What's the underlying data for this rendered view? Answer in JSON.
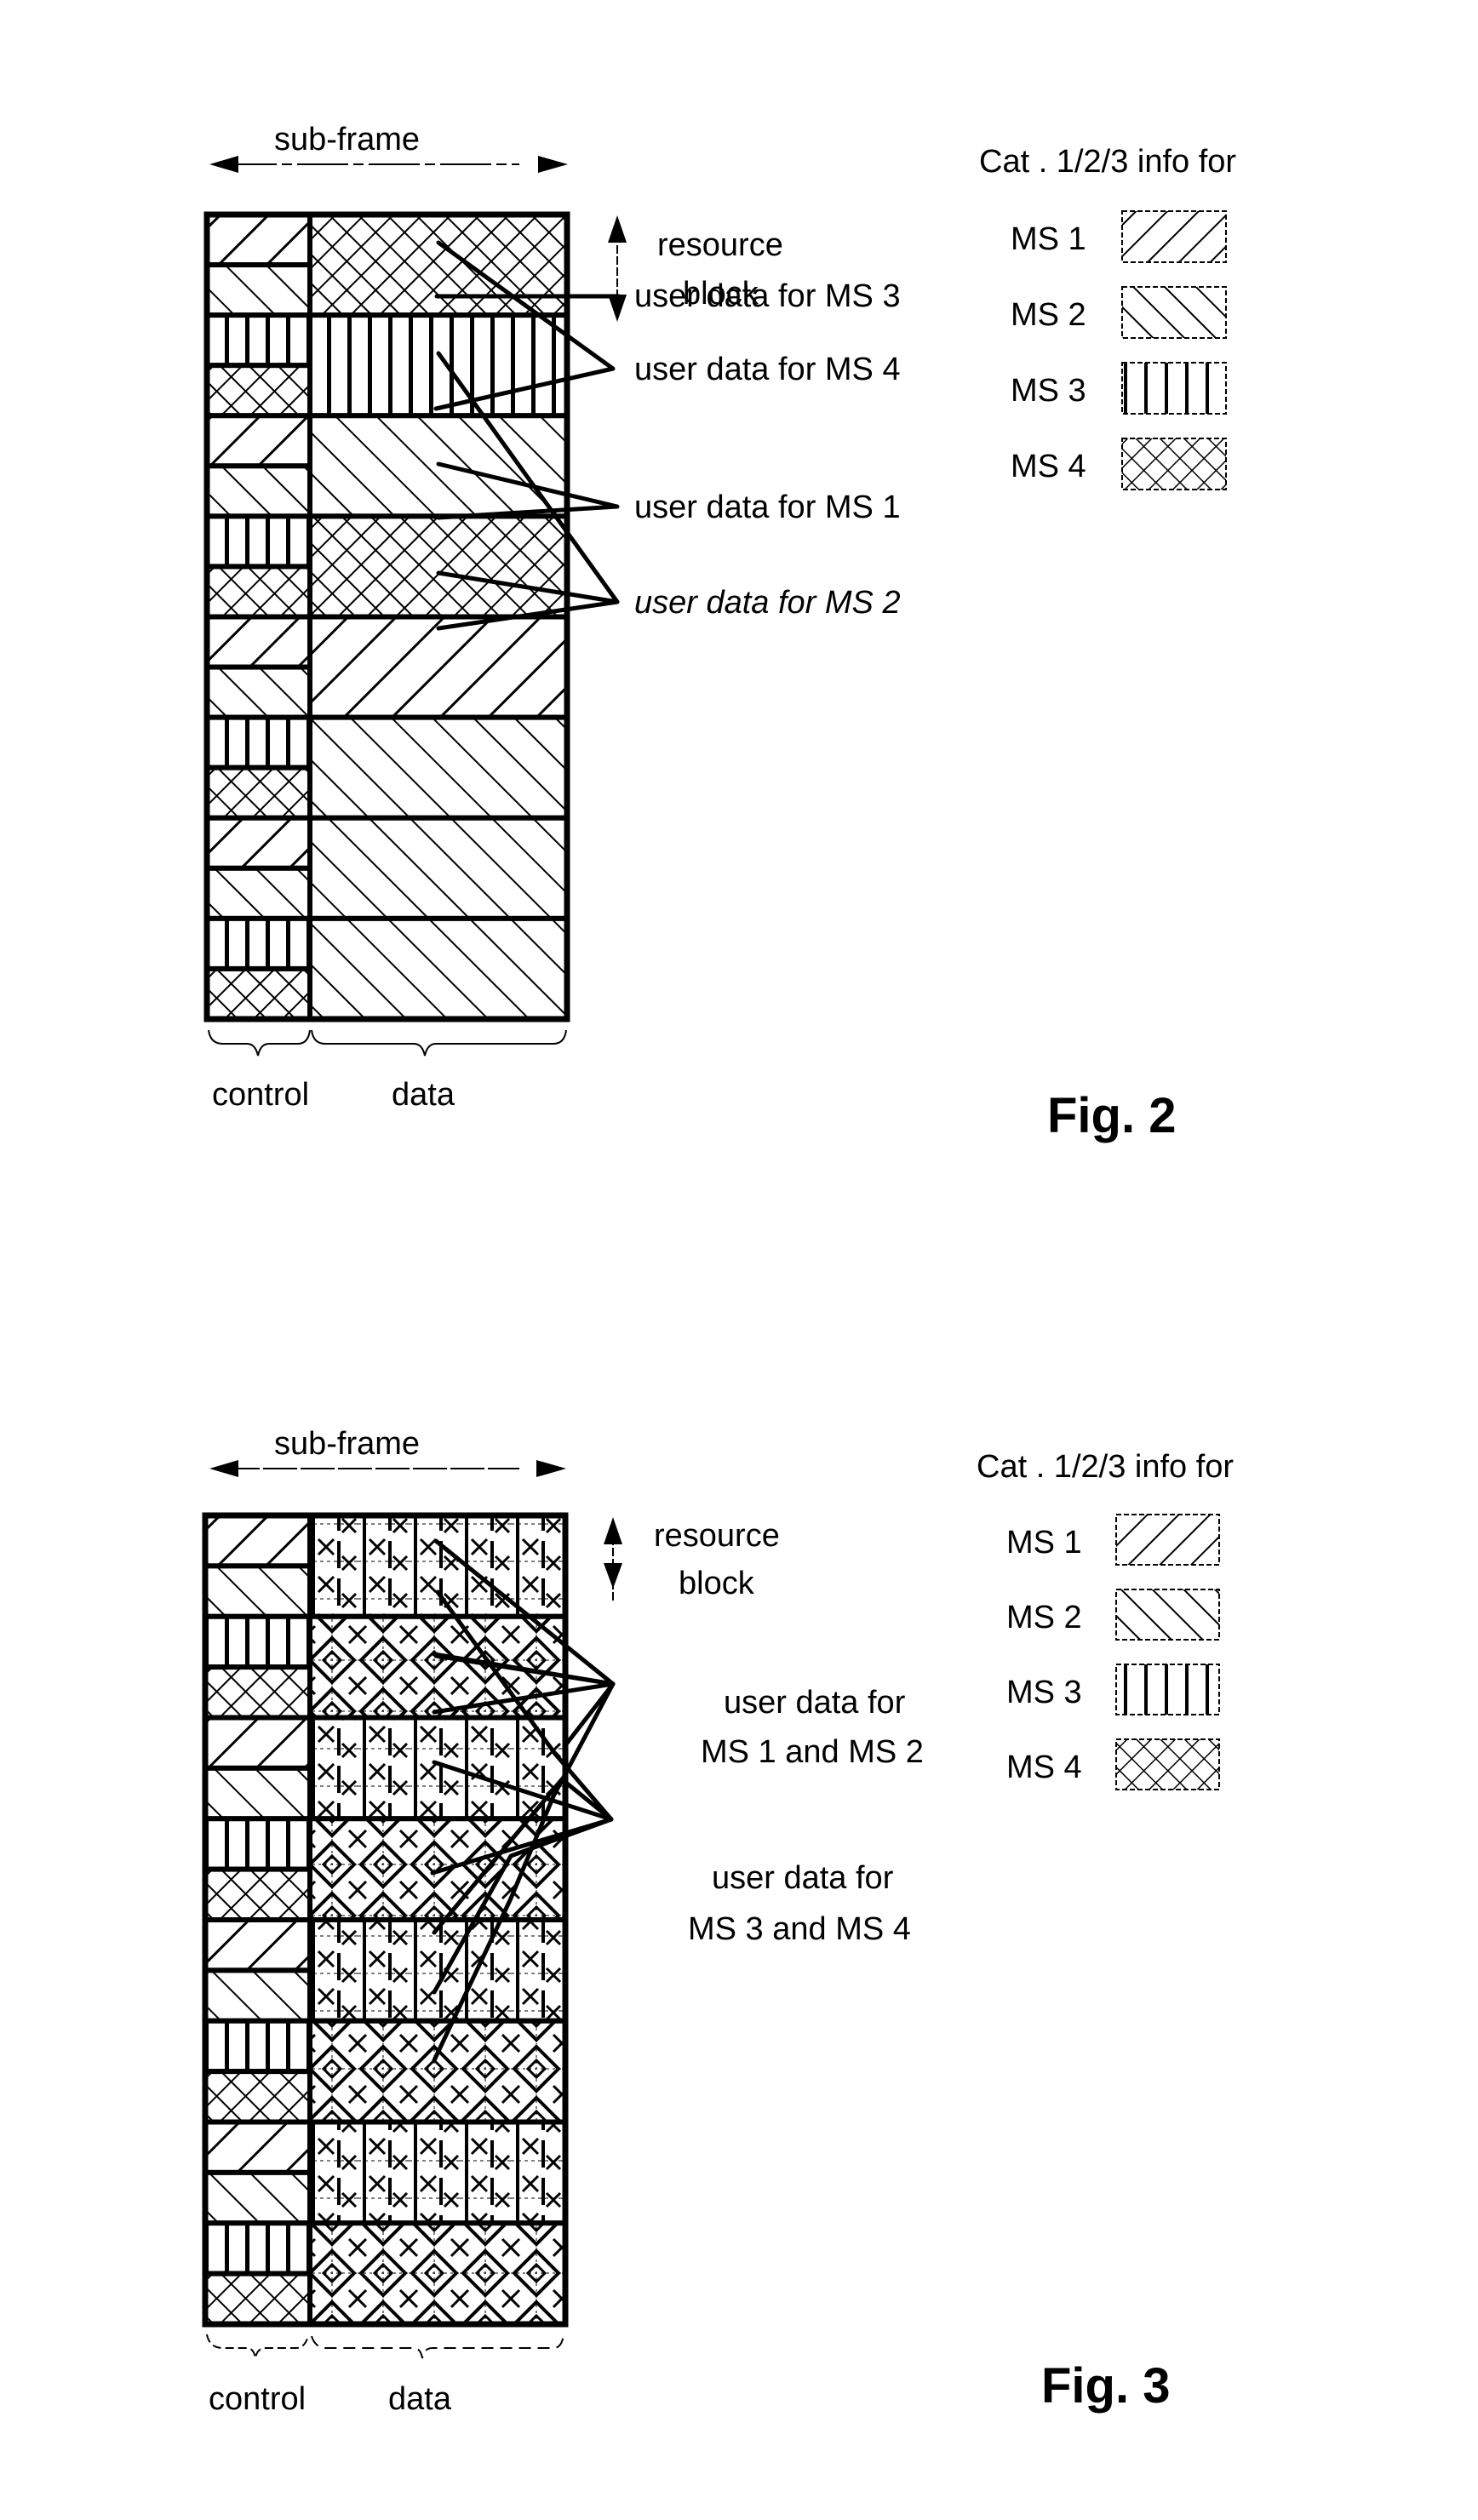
{
  "page": {
    "background": "#ffffff",
    "ink": "#000000"
  },
  "patterns": {
    "MS1": "diagonal-up",
    "MS2": "diagonal-down",
    "MS3": "vertical",
    "MS4": "crosshatch",
    "MS1+MS2": "combined-vertical-x",
    "MS3+MS4": "combined-diamond"
  },
  "figures": [
    {
      "id": "fig2",
      "caption": "Fig. 2",
      "subframe_label": "sub-frame",
      "resource_block_label": [
        "resource",
        "block"
      ],
      "bottom_labels": {
        "control": "control",
        "data": "data"
      },
      "legend": {
        "title": "Cat . 1/2/3 info for",
        "items": [
          {
            "label": "MS 1",
            "station": "MS1"
          },
          {
            "label": "MS 2",
            "station": "MS2"
          },
          {
            "label": "MS 3",
            "station": "MS3"
          },
          {
            "label": "MS 4",
            "station": "MS4"
          }
        ]
      },
      "control_subrows": [
        "MS1",
        "MS2",
        "MS3",
        "MS4",
        "MS1",
        "MS2",
        "MS3",
        "MS4",
        "MS1",
        "MS2",
        "MS3",
        "MS4",
        "MS1",
        "MS2",
        "MS3",
        "MS4"
      ],
      "data_rows": [
        "MS4",
        "MS3",
        "MS2",
        "MS4",
        "MS1",
        "MS2",
        "MS2",
        "MS2"
      ],
      "annotations": [
        {
          "text": "user data for MS 3"
        },
        {
          "text": "user data for MS 4"
        },
        {
          "text": "user data for MS 1"
        },
        {
          "text": "user data for MS 2"
        }
      ]
    },
    {
      "id": "fig3",
      "caption": "Fig. 3",
      "subframe_label": "sub-frame",
      "resource_block_label": [
        "resource",
        "block"
      ],
      "bottom_labels": {
        "control": "control",
        "data": "data"
      },
      "legend": {
        "title": "Cat . 1/2/3 info for",
        "items": [
          {
            "label": "MS 1",
            "station": "MS1"
          },
          {
            "label": "MS 2",
            "station": "MS2"
          },
          {
            "label": "MS 3",
            "station": "MS3"
          },
          {
            "label": "MS 4",
            "station": "MS4"
          }
        ]
      },
      "control_subrows": [
        "MS1",
        "MS2",
        "MS3",
        "MS4",
        "MS1",
        "MS2",
        "MS3",
        "MS4",
        "MS1",
        "MS2",
        "MS3",
        "MS4",
        "MS1",
        "MS2",
        "MS3",
        "MS4"
      ],
      "data_rows": [
        "MS1+MS2",
        "MS3+MS4",
        "MS1+MS2",
        "MS3+MS4",
        "MS1+MS2",
        "MS3+MS4",
        "MS1+MS2",
        "MS3+MS4"
      ],
      "annotations": [
        {
          "text_lines": [
            "user data for",
            "MS 1 and MS 2"
          ]
        },
        {
          "text_lines": [
            "user data for",
            "MS 3 and MS 4"
          ]
        }
      ]
    }
  ]
}
